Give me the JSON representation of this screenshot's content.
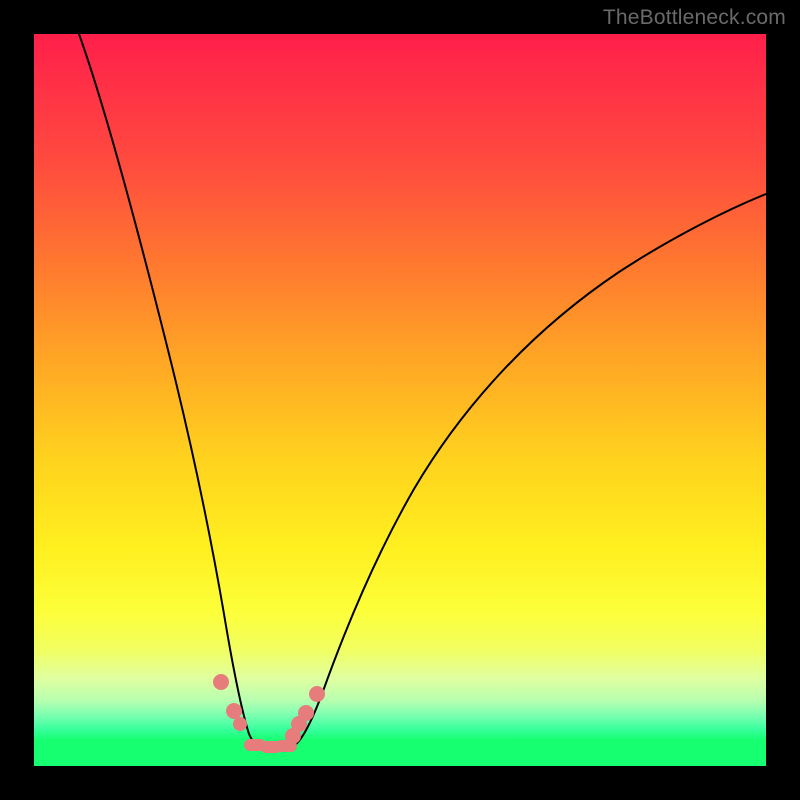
{
  "watermark": "TheBottleneck.com",
  "colors": {
    "gradient_top": "#ff1f4a",
    "gradient_mid": "#ffd21e",
    "gradient_bottom": "#15ff70",
    "curve": "#000000",
    "markers": "#e77c7c",
    "frame": "#000000"
  },
  "chart_data": {
    "type": "line",
    "title": "",
    "xlabel": "",
    "ylabel": "",
    "xlim": [
      0,
      100
    ],
    "ylim": [
      0,
      100
    ],
    "note": "Values estimated from pixels; axes have no visible tick labels. y increases upward; curve dips to ~0 near x≈31.",
    "series": [
      {
        "name": "bottleneck-curve",
        "x": [
          6,
          10,
          14,
          18,
          22,
          24,
          26,
          28,
          30,
          31,
          32,
          34,
          36,
          40,
          44,
          50,
          56,
          64,
          72,
          80,
          88,
          96,
          100
        ],
        "y": [
          100,
          86,
          72,
          57,
          40,
          31,
          22,
          14,
          6,
          3,
          2.5,
          2.5,
          4,
          10,
          18,
          30,
          39,
          49,
          57,
          63,
          68,
          72,
          74
        ]
      }
    ],
    "markers": [
      {
        "x": 25.5,
        "y": 11.5
      },
      {
        "x": 27.4,
        "y": 7.5
      },
      {
        "x": 28.2,
        "y": 5.8
      },
      {
        "x": 29.8,
        "y": 2.6,
        "shape": "oblong"
      },
      {
        "x": 31.5,
        "y": 2.4,
        "shape": "oblong"
      },
      {
        "x": 33.2,
        "y": 2.5,
        "shape": "oblong"
      },
      {
        "x": 35.0,
        "y": 3.8
      },
      {
        "x": 36.2,
        "y": 5.8
      },
      {
        "x": 37.2,
        "y": 7.3
      },
      {
        "x": 38.6,
        "y": 9.8
      }
    ]
  }
}
